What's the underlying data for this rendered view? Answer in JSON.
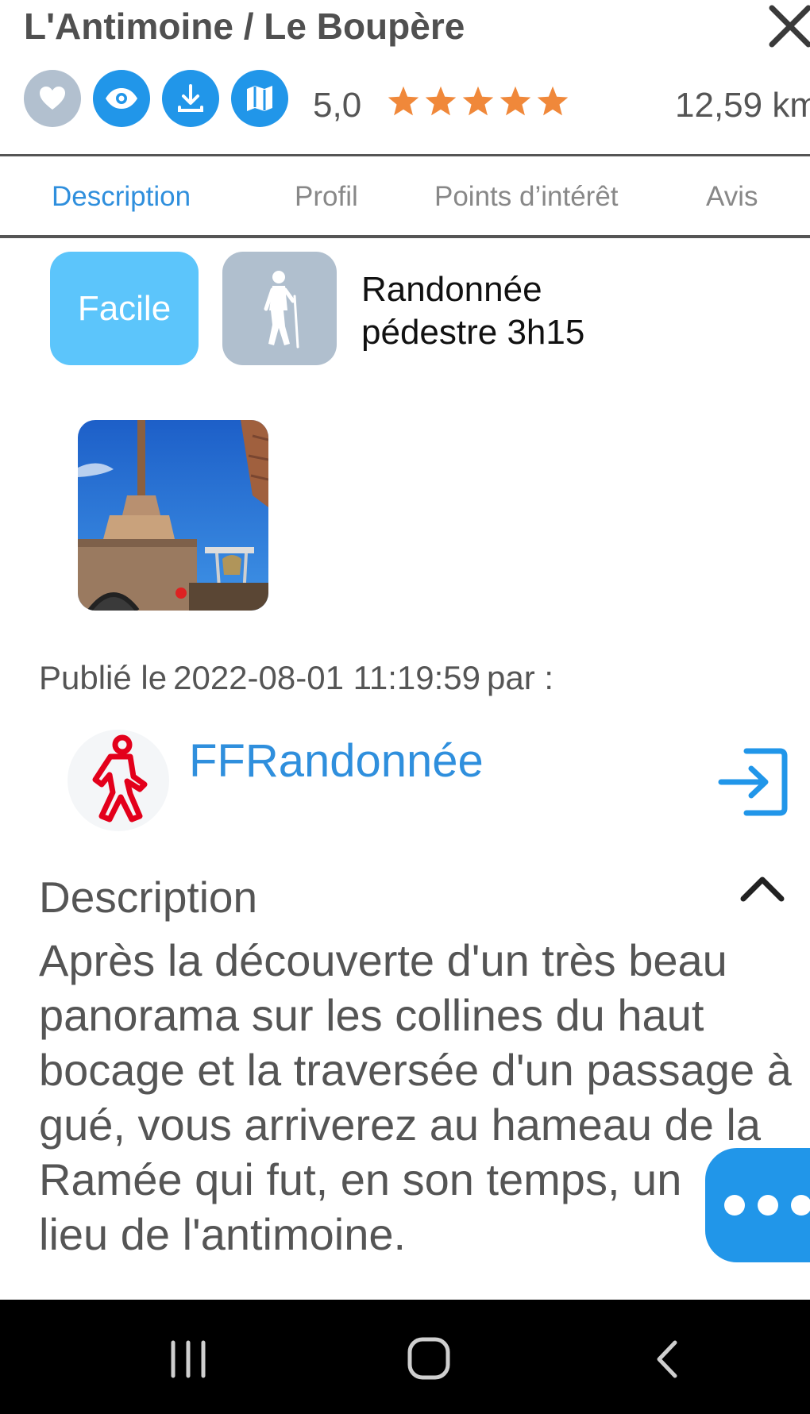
{
  "header": {
    "title": "L'Antimoine / Le Boupère",
    "rating": "5,0",
    "stars": 5,
    "distance": "12,59 km"
  },
  "tabs": [
    {
      "label": "Description",
      "active": true
    },
    {
      "label": "Profil",
      "active": false
    },
    {
      "label": "Points d’intérêt",
      "active": false
    },
    {
      "label": "Avis",
      "active": false
    }
  ],
  "summary": {
    "difficulty": "Facile",
    "activity": "Randonnée pédestre 3h15",
    "activity_icon": "hiker-icon"
  },
  "published": {
    "prefix": "Publié le",
    "date": "2022-08-01 11:19:59",
    "suffix": "par :",
    "author": "FFRandonnée"
  },
  "description": {
    "heading": "Description",
    "text": "Après la découverte d'un très beau\npanorama sur les collines du haut\nbocage et la traversée d'un passage à\ngué, vous arriverez au hameau de la\nRamée qui fut, en son temps, un\nlieu de l'antimoine."
  },
  "colors": {
    "accent": "#2196e9",
    "link": "#2f8fdd",
    "difficulty_chip": "#5cc5fb",
    "activity_chip": "#b0bfce",
    "stars": "#f0883a"
  }
}
